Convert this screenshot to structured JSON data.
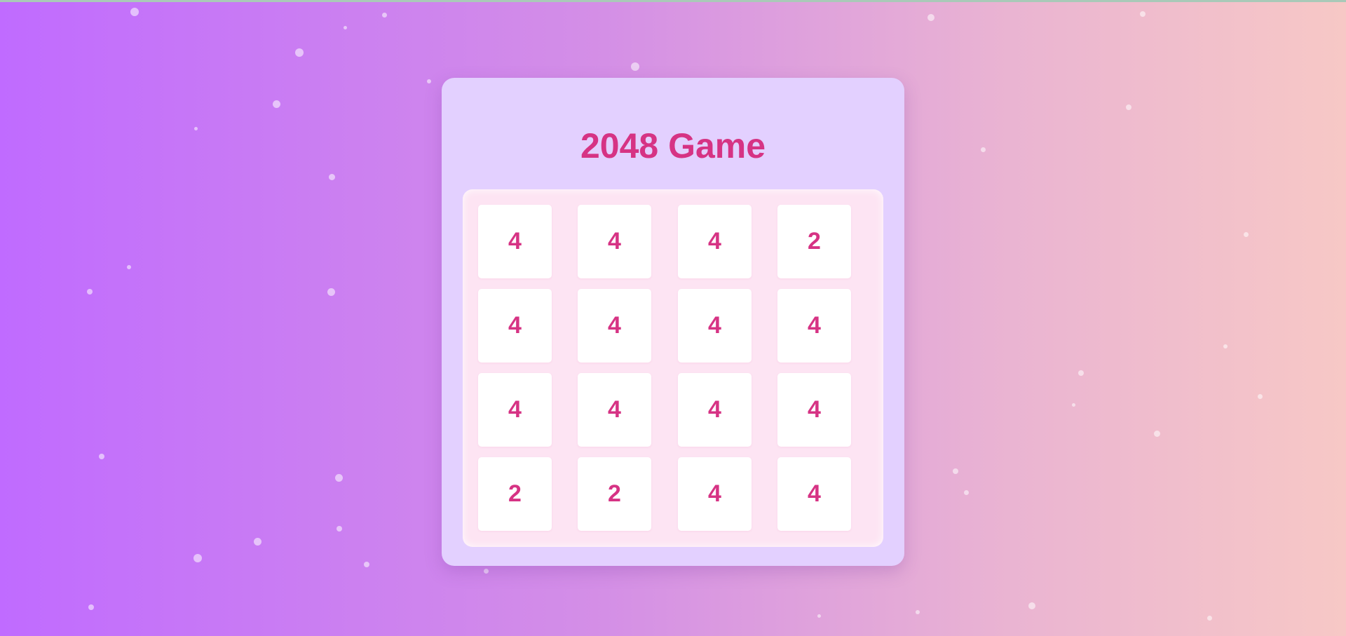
{
  "game": {
    "title": "2048 Game",
    "board": [
      [
        "4",
        "4",
        "4",
        "2"
      ],
      [
        "4",
        "4",
        "4",
        "4"
      ],
      [
        "4",
        "4",
        "4",
        "4"
      ],
      [
        "2",
        "2",
        "4",
        "4"
      ]
    ]
  },
  "colors": {
    "background_start": "#c06bff",
    "background_end": "#f7c8c6",
    "card": "#e3d0ff",
    "board": "#fde4f3",
    "tile": "#ffffff",
    "accent": "#d63384"
  }
}
